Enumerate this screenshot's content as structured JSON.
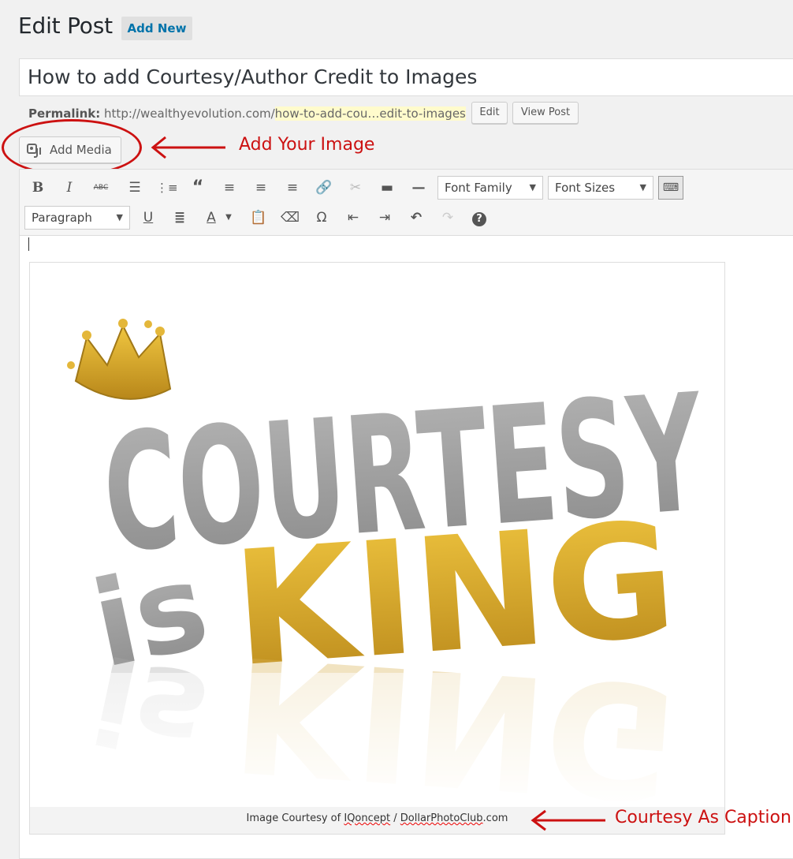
{
  "header": {
    "title": "Edit Post",
    "add_new_label": "Add New"
  },
  "post": {
    "title": "How to add Courtesy/Author Credit to Images",
    "permalink_label": "Permalink:",
    "permalink_base": "http://wealthyevolution.com/",
    "permalink_slug": "how-to-add-cou…edit-to-images",
    "edit_label": "Edit",
    "view_label": "View Post"
  },
  "media": {
    "add_media_label": "Add Media"
  },
  "annotations": {
    "add_image": "Add Your Image",
    "caption": "Courtesy As Caption",
    "color": "#cc1111"
  },
  "toolbar": {
    "font_family": "Font Family",
    "font_sizes": "Font Sizes",
    "format": "Paragraph",
    "row1_icons": [
      "bold-icon",
      "italic-icon",
      "strikethrough-icon",
      "bullet-list-icon",
      "numbered-list-icon",
      "blockquote-icon",
      "align-left-icon",
      "align-center-icon",
      "align-right-icon",
      "link-icon",
      "unlink-icon",
      "read-more-icon",
      "horizontal-rule-icon",
      "toolbar-toggle-icon"
    ],
    "row2_icons": [
      "underline-icon",
      "justify-icon",
      "text-color-icon",
      "paste-text-icon",
      "clear-formatting-icon",
      "special-character-icon",
      "outdent-icon",
      "indent-icon",
      "undo-icon",
      "redo-icon",
      "help-icon"
    ]
  },
  "image": {
    "text_line1": "COURTESY",
    "text_line2a": "is",
    "text_line2b": "KING",
    "caption_prefix": "Image Courtesy of ",
    "caption_author": "IQoncept",
    "caption_sep": " / ",
    "caption_source": "DollarPhotoClub",
    "caption_suffix": ".com",
    "colors": {
      "grey": "#9a9a9a",
      "gold": "#d9a82a"
    }
  }
}
